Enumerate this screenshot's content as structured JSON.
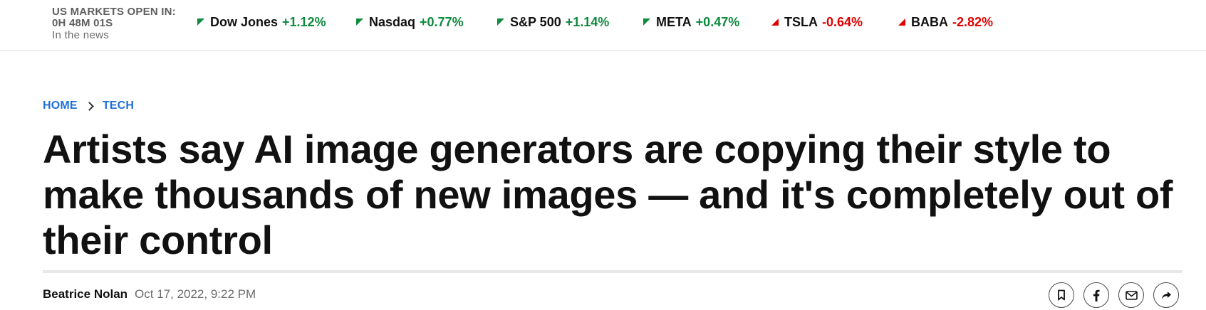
{
  "market": {
    "status_title": "US MARKETS OPEN IN:",
    "countdown": "0H 48M 01S",
    "news_label": "In the news"
  },
  "tickers": [
    {
      "name": "Dow Jones",
      "change": "+1.12%",
      "direction": "up"
    },
    {
      "name": "Nasdaq",
      "change": "+0.77%",
      "direction": "up"
    },
    {
      "name": "S&P 500",
      "change": "+1.14%",
      "direction": "up"
    },
    {
      "name": "META",
      "change": "+0.47%",
      "direction": "up"
    },
    {
      "name": "TSLA",
      "change": "-0.64%",
      "direction": "down"
    },
    {
      "name": "BABA",
      "change": "-2.82%",
      "direction": "down"
    }
  ],
  "colors": {
    "positive": "#0d8a3c",
    "negative": "#e00000",
    "link": "#1f6fd8"
  },
  "breadcrumb": {
    "home": "HOME",
    "section": "TECH"
  },
  "article": {
    "headline": "Artists say AI image generators are copying their style to make thousands of new images — and it's completely out of their control",
    "author": "Beatrice Nolan",
    "date": "Oct 17, 2022, 9:22 PM"
  },
  "share_icons": [
    "bookmark-icon",
    "facebook-icon",
    "email-icon",
    "share-icon"
  ]
}
